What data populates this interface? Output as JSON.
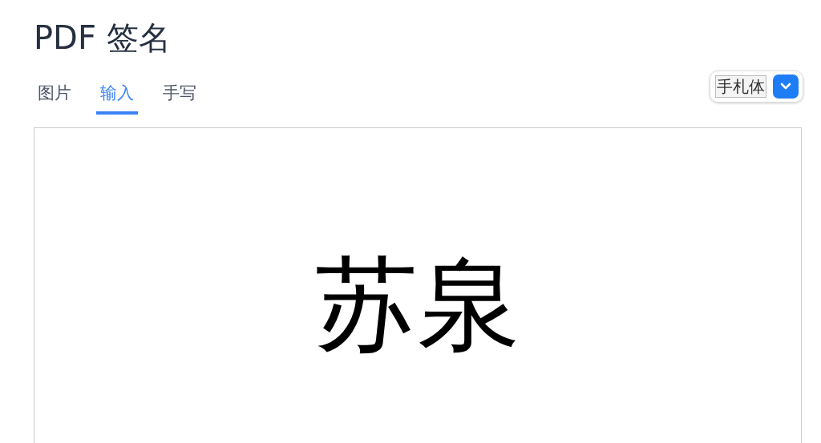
{
  "title": "PDF 签名",
  "tabs": [
    {
      "label": "图片",
      "selected": false
    },
    {
      "label": "输入",
      "selected": true
    },
    {
      "label": "手写",
      "selected": false
    }
  ],
  "font_select": {
    "value": "手札体"
  },
  "signature": {
    "text": "苏泉"
  }
}
